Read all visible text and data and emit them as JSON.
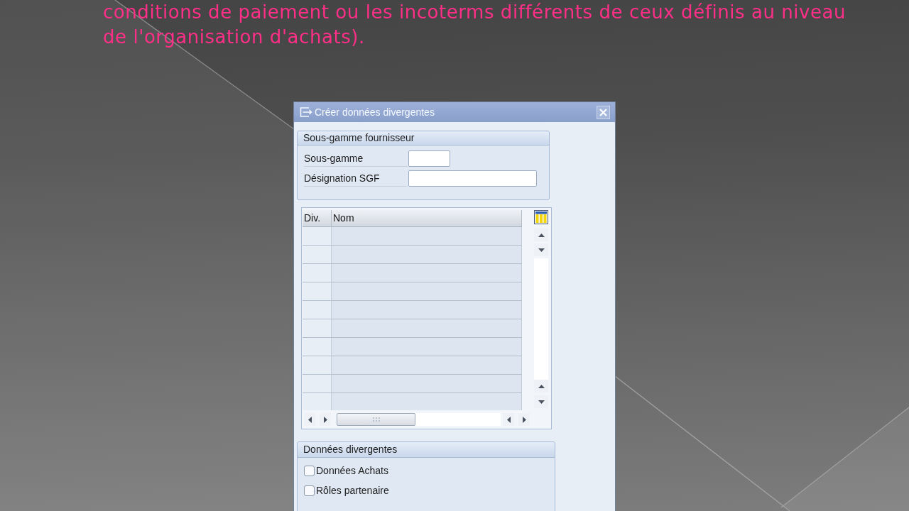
{
  "slide_text": {
    "lines": [
      "conditions de paiement ou les incoterms différents de ceux définis au niveau",
      "de l'organisation d'achats)."
    ]
  },
  "dialog": {
    "title": "Créer données divergentes",
    "supplier_subrange": {
      "title": "Sous-gamme fournisseur",
      "fields": [
        {
          "label": "Sous-gamme"
        },
        {
          "label": "Désignation SGF"
        }
      ]
    },
    "table": {
      "columns": [
        "Div.",
        "Nom"
      ]
    },
    "divergent_data": {
      "title": "Données divergentes",
      "options": [
        {
          "label": "Données Achats",
          "checked": false
        },
        {
          "label": "Rôles partenaire",
          "checked": false
        }
      ]
    }
  }
}
